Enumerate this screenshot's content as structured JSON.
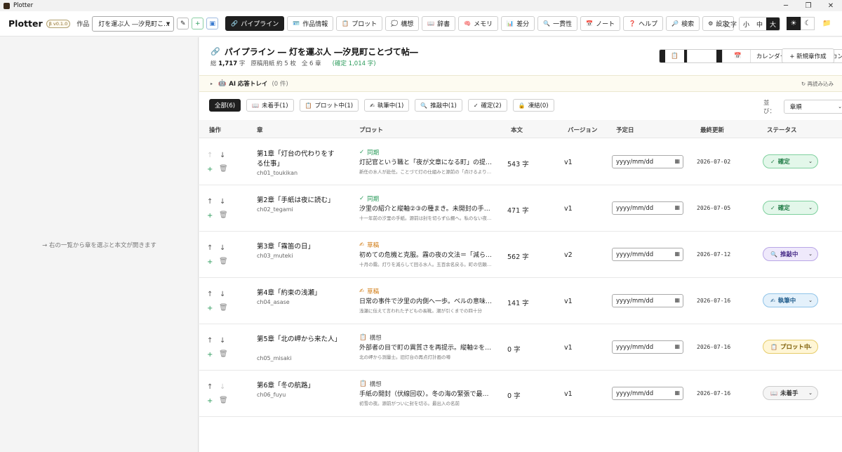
{
  "titlebar": {
    "title": "Plotter",
    "minimize": "─",
    "maximize": "❐",
    "close": "✕"
  },
  "toolbar": {
    "logo": "Plotter",
    "version": "β v0.1.0",
    "work_label": "作品",
    "work_value": "灯を運ぶ人 ―汐見町こ…",
    "edit_glyph": "✎",
    "add_glyph": "+",
    "save_glyph": "▣",
    "nav": [
      {
        "label": "パイプライン",
        "icon": "🔗"
      },
      {
        "label": "作品情報",
        "icon": "🪪"
      },
      {
        "label": "プロット",
        "icon": "📋"
      },
      {
        "label": "構想",
        "icon": "💭"
      },
      {
        "label": "辞書",
        "icon": "📖"
      },
      {
        "label": "メモリ",
        "icon": "🧠"
      },
      {
        "label": "差分",
        "icon": "📊"
      },
      {
        "label": "一貫性",
        "icon": "🔍"
      },
      {
        "label": "ノート",
        "icon": "📅"
      },
      {
        "label": "ヘルプ",
        "icon": "❓"
      },
      {
        "label": "検索",
        "icon": "🔎"
      },
      {
        "label": "設定",
        "icon": "⚙"
      }
    ],
    "font_label": "文字",
    "font_sizes": [
      "小",
      "中",
      "大"
    ],
    "theme_light": "☀",
    "theme_dark": "☾",
    "folder_icon": "📁"
  },
  "left": {
    "hint": "→ 右の一覧から章を選ぶと本文が開きます"
  },
  "main": {
    "title_icon": "🔗",
    "title": "パイプライン ― 灯を運ぶ人 ―汐見町ことづて帖―",
    "stats": {
      "total_prefix": "総",
      "total_value": "1,717",
      "total_suffix": "字",
      "manuscript": "原稿用紙 約 5 枚",
      "chapters": "全 6 章",
      "confirmed": "(確定 1,014 字)"
    },
    "views": [
      {
        "label": "リスト",
        "icon": "📋"
      },
      {
        "label": "カレンダー",
        "icon": "📅"
      },
      {
        "label": "カンバン",
        "icon": "📁"
      }
    ],
    "new_button": "+ 新規章作成",
    "tray": {
      "arrow": "▸",
      "icon": "🤖",
      "label": "AI 応答トレイ",
      "count": "(0 件)",
      "reload": "↻ 再読み込み"
    },
    "filters": [
      {
        "label": "全部(6)",
        "icon": ""
      },
      {
        "label": "未着手(1)",
        "icon": "📖"
      },
      {
        "label": "プロット中(1)",
        "icon": "📋"
      },
      {
        "label": "執筆中(1)",
        "icon": "✍"
      },
      {
        "label": "推敲中(1)",
        "icon": "🔍"
      },
      {
        "label": "確定(2)",
        "icon": "✓"
      },
      {
        "label": "凍結(0)",
        "icon": "🔒"
      }
    ],
    "sort_label": "並び：",
    "sort_value": "章順",
    "columns": {
      "ops": "操作",
      "chapter": "章",
      "plot": "プロット",
      "body": "本文",
      "version": "バージョン",
      "due": "予定日",
      "updated": "最終更新",
      "status": "ステータス"
    },
    "date_placeholder": "yyyy/mm/dd",
    "rows": [
      {
        "title": "第1章「灯台の代わりをする仕事」",
        "id": "ch01_toukikan",
        "plot_status": "同期",
        "plot_icon": "✓",
        "plot_color": "#2a9a5a",
        "summary": "灯記官という職と「夜が文章になる町」の提示。源前…",
        "note": "新任の水人が赴任。ことづて灯の仕組みと源前の「点けるより消すほうが…",
        "body": "543 字",
        "version": "v1",
        "updated": "2026-07-02",
        "status": "確定",
        "status_icon": "✓",
        "status_bg": "#e3f7ea",
        "status_border": "#7fd09e",
        "status_color": "#1e7a44",
        "up_dim": true,
        "down_dim": false
      },
      {
        "title": "第2章「手紙は夜に読む」",
        "id": "ch02_tegami",
        "plot_status": "同期",
        "plot_icon": "✓",
        "plot_color": "#2a9a5a",
        "summary": "汐里の紹介と縦軸②③の種まき。未開封の手紙を…",
        "note": "十一年前の汐里の手紙。源前は封を切らず仏棚へ。私のない夜に一つ…",
        "body": "471 字",
        "version": "v1",
        "updated": "2026-07-05",
        "status": "確定",
        "status_icon": "✓",
        "status_bg": "#e3f7ea",
        "status_border": "#7fd09e",
        "status_color": "#1e7a44",
        "up_dim": false,
        "down_dim": false
      },
      {
        "title": "第3章「霧笛の日」",
        "id": "ch03_muteki",
        "plot_status": "草稿",
        "plot_icon": "✍",
        "plot_color": "#d07a10",
        "summary": "初めての危機と克服。霧の夜の文法＝「減らす」で源…",
        "note": "十月の霧。灯りを減らして回る水人。五百余名戻る。町の信頼の芽生",
        "body": "562 字",
        "version": "v2",
        "updated": "2026-07-12",
        "status": "推敲中",
        "status_icon": "🔍",
        "status_bg": "#efe9fb",
        "status_border": "#b9a6e6",
        "status_color": "#4a2e8a",
        "up_dim": false,
        "down_dim": false
      },
      {
        "title": "第4章「約束の浅瀬」",
        "id": "ch04_asase",
        "plot_status": "草稿",
        "plot_icon": "✍",
        "plot_color": "#d07a10",
        "summary": "日常の事件で汐里の内側へ一歩。ベルの意味に触…",
        "note": "浅瀬に伝えて言われた子どもの長靴。潮が引くまでの四十分",
        "body": "141 字",
        "version": "v1",
        "updated": "2026-07-16",
        "status": "執筆中",
        "status_icon": "✍",
        "status_bg": "#e4f1fb",
        "status_border": "#8fc3e8",
        "status_color": "#1d5a8a",
        "up_dim": false,
        "down_dim": false
      },
      {
        "title": "第5章「北の岬から来た人」",
        "id": "ch05_misaki",
        "plot_status": "構想",
        "plot_icon": "📋",
        "plot_color": "#555555",
        "summary": "外部者の目で町の異質さを再提示。縦軸②を1滴",
        "note": "北の岬から測量士。旧灯台の再点灯計画の噂",
        "body": "0 字",
        "version": "v1",
        "updated": "2026-07-16",
        "status": "プロット中",
        "status_icon": "📋",
        "status_bg": "#fff6d6",
        "status_border": "#e6cc6a",
        "status_color": "#7a5a00",
        "up_dim": false,
        "down_dim": false
      },
      {
        "title": "第6章「冬の航路」",
        "id": "ch06_fuyu",
        "plot_status": "構想",
        "plot_icon": "📋",
        "plot_color": "#555555",
        "summary": "手紙の開封（伏線回収）。冬の海の緊張で最終…",
        "note": "初雪の夜。源前がついに封を切る。最出入の名前",
        "body": "0 字",
        "version": "v1",
        "updated": "2026-07-16",
        "status": "未着手",
        "status_icon": "📖",
        "status_bg": "#f5f5f5",
        "status_border": "#cccccc",
        "status_color": "#333333",
        "up_dim": false,
        "down_dim": true
      }
    ]
  }
}
